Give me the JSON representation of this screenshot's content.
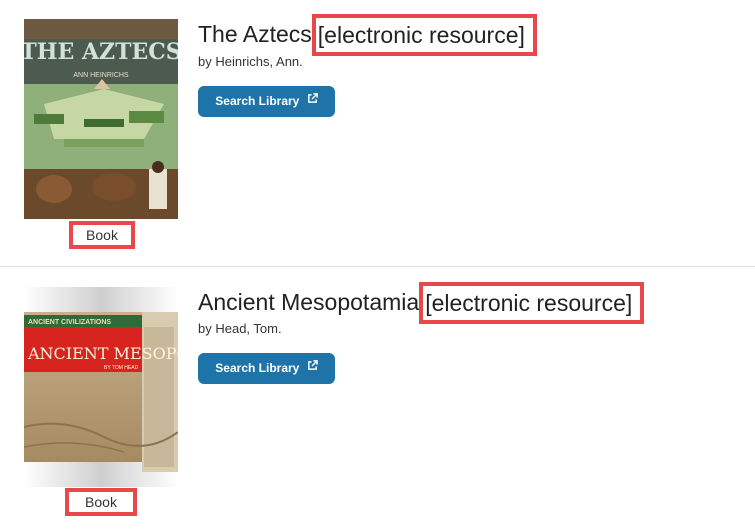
{
  "results": [
    {
      "title": "The Aztecs",
      "qualifier": "[electronic resource]",
      "author": "by Heinrichs, Ann.",
      "button_label": "Search Library",
      "format": "Book",
      "cover": {
        "series_text": "",
        "title_text": "THE AZTECS",
        "author_text": "ANN HEINRICHS"
      }
    },
    {
      "title": "Ancient Mesopotamia",
      "qualifier": "[electronic resource]",
      "author": "by Head, Tom.",
      "button_label": "Search Library",
      "format": "Book",
      "cover": {
        "series_text": "ANCIENT CIVILIZATIONS",
        "title_text": "ANCIENT MESOPOTAMIA",
        "author_text": "BY TOM HEAD"
      }
    }
  ],
  "colors": {
    "button": "#1e73a8",
    "highlight": "#e8484b",
    "divider": "#dcdcdc"
  },
  "icons": {
    "button_icon": "external-link-icon"
  }
}
